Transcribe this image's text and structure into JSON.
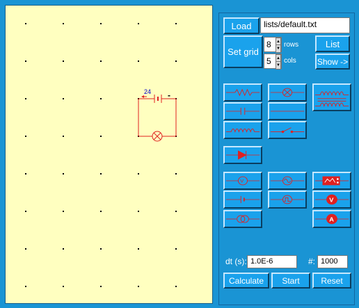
{
  "load": {
    "button_label": "Load",
    "file_path": "lists/default.txt"
  },
  "grid": {
    "button_label": "Set grid",
    "rows_value": "8",
    "rows_label": "rows",
    "cols_value": "5",
    "cols_label": "cols"
  },
  "list": {
    "button_label": "List",
    "show_label": "Show ->"
  },
  "circuit": {
    "voltage_label": "24",
    "minus_label": "-"
  },
  "sim": {
    "dt_label": "dt (s):",
    "dt_value": "1.0E-6",
    "count_label": "#:",
    "count_value": "1000"
  },
  "actions": {
    "calculate_label": "Calculate",
    "start_label": "Start",
    "reset_label": "Reset"
  },
  "colors": {
    "accent": "#1a94d4",
    "canvas_bg": "#ffffc0",
    "wire": "#e02020",
    "button": "#1aa2ec"
  },
  "tools": [
    {
      "name": "resistor-tool"
    },
    {
      "name": "lamp-tool"
    },
    {
      "name": "transformer-tool"
    },
    {
      "name": "capacitor-tool"
    },
    {
      "name": "wire-tool"
    },
    {
      "name": "inductor-tool"
    },
    {
      "name": "switch-tool"
    },
    {
      "name": "diode-tool"
    },
    {
      "name": "ac-source-tool"
    },
    {
      "name": "sine-source-tool"
    },
    {
      "name": "oscilloscope-tool"
    },
    {
      "name": "dc-battery-tool"
    },
    {
      "name": "pulse-source-tool"
    },
    {
      "name": "voltmeter-tool"
    },
    {
      "name": "current-source-tool"
    },
    {
      "name": "ammeter-tool"
    }
  ]
}
